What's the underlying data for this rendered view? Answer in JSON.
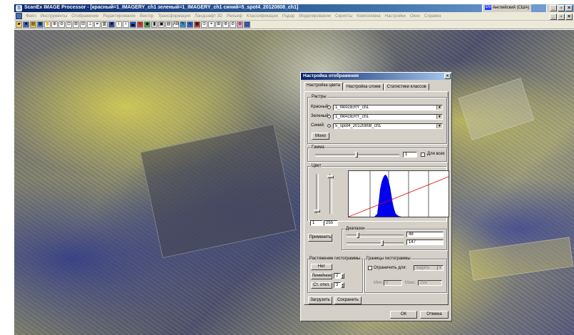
{
  "window": {
    "title": "ScanEx IMAGE Processor - [красный=1_IMAGERY_ch1 зеленый=1_IMAGERY_ch1 синий=5_spot4_20120808_ch1]",
    "language": "Английский (США)",
    "lang_code": "EN",
    "help_label": "?"
  },
  "menu": [
    "Файл",
    "Инструменты",
    "Отображение",
    "Редактирование",
    "Вектор",
    "Трансформация",
    "Ландшафт 3D",
    "Рельеф",
    "Классификация",
    "Радар",
    "Моделирование",
    "Скрипты",
    "Компоновка",
    "Настройки",
    "Окно",
    "Справка"
  ],
  "toolbar_icons": [
    "open-icon",
    "save-icon",
    "layers-icon",
    "grid-icon",
    "pan-icon",
    "zoom-in-icon",
    "zoom-out-icon",
    "zoom-window-icon",
    "zoom-fit-icon",
    "zoom-layer-icon",
    "measure-icon",
    "scale-icon",
    "split-icon",
    "overview-icon",
    "info-icon",
    "identify-icon",
    "histogram-icon",
    "profile-icon",
    "classes-icon",
    "legend-icon",
    "layout-icon",
    "table-icon",
    "ab-icon",
    "draw-icon",
    "vector-icon",
    "raster-icon",
    "rotate-icon",
    "crosshair-icon",
    "navigator-icon",
    "settings-icon",
    "search-icon",
    "palette-icon",
    "export-icon"
  ],
  "dialog": {
    "title": "Настройка отображения",
    "close": "×",
    "tabs": [
      "Настройка цвета",
      "Настройка слоев",
      "Статистики классов"
    ],
    "rasters_group": "Растры",
    "channels": [
      {
        "label": "Красный:",
        "value": "1_IMAGERY_ch1",
        "selected": false
      },
      {
        "label": "Зеленый:",
        "value": "1_IMAGERY_ch1",
        "selected": false
      },
      {
        "label": "Синий:",
        "value": "5_spot4_20120808_ch1",
        "selected": true
      }
    ],
    "mono_button": "Моно",
    "gamma_group": "Гамма",
    "gamma_value": "1",
    "all_label": "Для всех",
    "color_group": "Цвет",
    "color_min": "1",
    "color_max": "255",
    "apply_button": "Применить",
    "range_group": "Диапазон",
    "range_low": "48",
    "range_high": "147",
    "stretch_group": "Растяжение гистограммы",
    "stretch_none": "Нет",
    "stretch_linear": "Линейное",
    "stretch_linear_value": "2",
    "stretch_stddev": "Ст. откл.",
    "stretch_stddev_value": "3",
    "bounds_group": "Границы гистограммы",
    "limit_label": "Ограничить для:",
    "limit_option": "Задать",
    "min_label": "Мин:",
    "min_value": "0",
    "max_label": "Макс:",
    "max_value": "255",
    "load_button": "Загрузить",
    "save_button": "Сохранить",
    "ok_button": "ОК",
    "cancel_button": "Отмена"
  }
}
